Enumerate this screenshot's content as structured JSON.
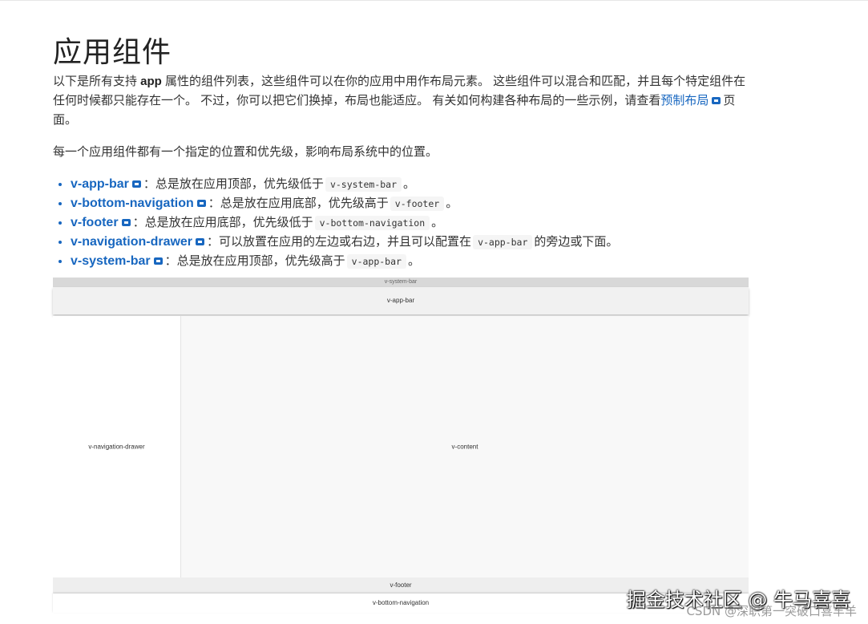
{
  "title": "应用组件",
  "intro": {
    "part1": "以下是所有支持 ",
    "app_word": "app",
    "part2": " 属性的组件列表，这些组件可以在你的应用中用作布局元素。 这些组件可以混合和匹配，并且每个特定组件在任何时候都只能存在一个。 不过，你可以把它们换掉，布局也能适应。 有关如何构建各种布局的一些示例，请查看",
    "link": "预制布局",
    "part3": "页面。"
  },
  "paragraph2": "每一个应用组件都有一个指定的位置和优先级，影响布局系统中的位置。",
  "items": [
    {
      "name": "v-app-bar",
      "sep": "：",
      "text": "总是放在应用顶部，优先级低于",
      "code": "v-system-bar",
      "tail": "。"
    },
    {
      "name": "v-bottom-navigation",
      "sep": "：",
      "text": "总是放在应用底部，优先级高于",
      "code": "v-footer",
      "tail": "。"
    },
    {
      "name": "v-footer",
      "sep": "：",
      "text": "总是放在应用底部，优先级低于",
      "code": "v-bottom-navigation",
      "tail": "。"
    },
    {
      "name": "v-navigation-drawer",
      "sep": "：",
      "text": "可以放置在应用的左边或右边，并且可以配置在",
      "code": "v-app-bar",
      "tail": "的旁边或下面。"
    },
    {
      "name": "v-system-bar",
      "sep": "：",
      "text": "总是放在应用顶部，优先级高于",
      "code": "v-app-bar",
      "tail": "。"
    }
  ],
  "diagram": {
    "system_bar": "v-system-bar",
    "app_bar": "v-app-bar",
    "navigation_drawer": "v-navigation-drawer",
    "content": "v-content",
    "footer": "v-footer",
    "bottom_navigation": "v-bottom-navigation"
  },
  "watermark": {
    "line1": "掘金技术社区 @ 牛马喜喜",
    "line2": "CSDN @深职第一突破口喜羊羊"
  },
  "colors": {
    "link": "#1867c0",
    "text": "#333333"
  },
  "icons": {
    "external": "external-link-icon"
  }
}
